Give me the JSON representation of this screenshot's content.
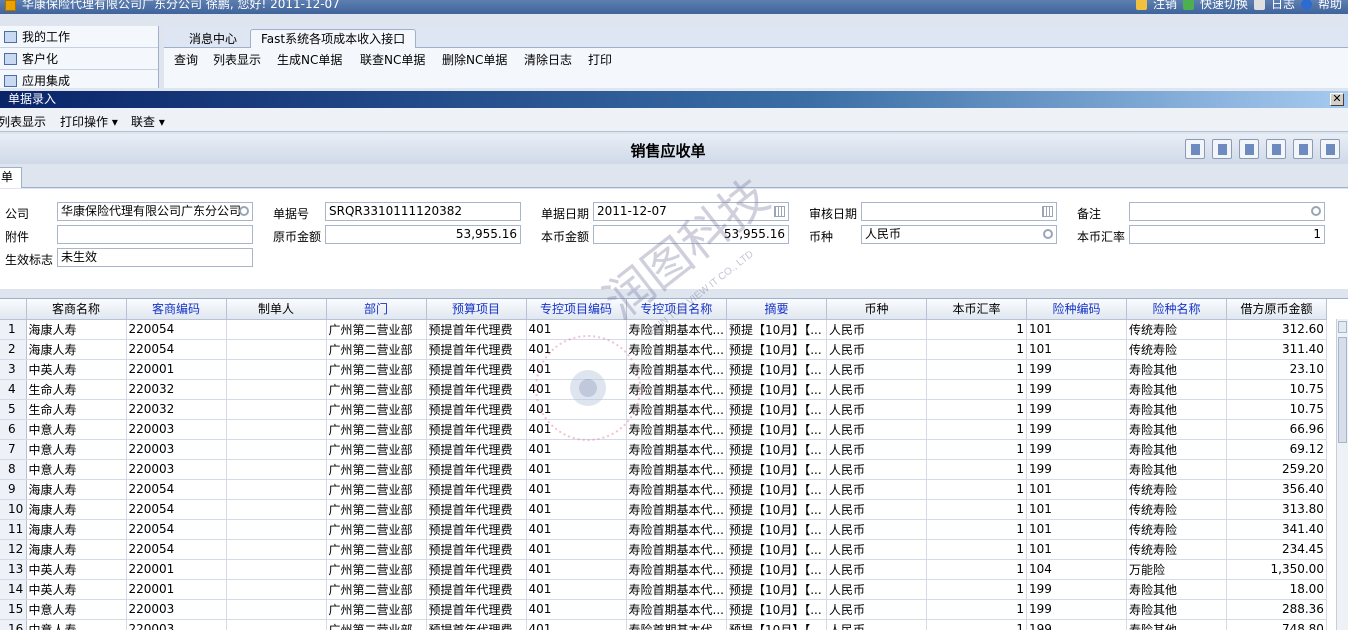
{
  "app": {
    "title": "华康保险代理有限公司广东分公司 徐鹏, 您好! 2011-12-07",
    "top_links": [
      "注销",
      "快速切换",
      "日志",
      "帮助"
    ]
  },
  "left_nav": {
    "items": [
      "我的工作",
      "客户化",
      "应用集成"
    ]
  },
  "tabs": [
    "消息中心",
    "Fast系统各项成本收入接口"
  ],
  "toolbar": [
    "查询",
    "列表显示",
    "生成NC单据",
    "联查NC单据",
    "删除NC单据",
    "清除日志",
    "打印"
  ],
  "window": {
    "title": "单据录入",
    "close": "✕"
  },
  "menu": [
    "列表显示",
    "打印操作 ▾",
    "联查 ▾"
  ],
  "form_title": "销售应收单",
  "sub_tab": "单据",
  "form": {
    "company_label": "公司",
    "company_value": "华康保险代理有限公司广东分公司",
    "doc_no_label": "单据号",
    "doc_no_value": "SRQR3310111120382",
    "doc_date_label": "单据日期",
    "doc_date_value": "2011-12-07",
    "audit_date_label": "审核日期",
    "audit_date_value": "",
    "remark_label": "备注",
    "remark_value": "",
    "attach_label": "附件",
    "attach_value": "",
    "orig_amount_label": "原币金额",
    "orig_amount_value": "53,955.16",
    "local_amount_label": "本币金额",
    "local_amount_value": "53,955.16",
    "currency_label": "币种",
    "currency_value": "人民币",
    "rate_label": "本币汇率",
    "rate_value": "1",
    "status_label": "生效标志",
    "status_value": "未生效"
  },
  "grid": {
    "columns": [
      "客商名称",
      "客商编码",
      "制单人",
      "部门",
      "预算项目",
      "专控项目编码",
      "专控项目名称",
      "摘要",
      "币种",
      "本币汇率",
      "险种编码",
      "险种名称",
      "借方原币金额"
    ],
    "rows": [
      [
        "1",
        "海康人寿",
        "220054",
        "",
        "广州第二营业部",
        "预提首年代理费",
        "401",
        "寿险首期基本代...",
        "预提【10月】【...",
        "人民币",
        "1",
        "101",
        "传统寿险",
        "312.60"
      ],
      [
        "2",
        "海康人寿",
        "220054",
        "",
        "广州第二营业部",
        "预提首年代理费",
        "401",
        "寿险首期基本代...",
        "预提【10月】【...",
        "人民币",
        "1",
        "101",
        "传统寿险",
        "311.40"
      ],
      [
        "3",
        "中英人寿",
        "220001",
        "",
        "广州第二营业部",
        "预提首年代理费",
        "401",
        "寿险首期基本代...",
        "预提【10月】【...",
        "人民币",
        "1",
        "199",
        "寿险其他",
        "23.10"
      ],
      [
        "4",
        "生命人寿",
        "220032",
        "",
        "广州第二营业部",
        "预提首年代理费",
        "401",
        "寿险首期基本代...",
        "预提【10月】【...",
        "人民币",
        "1",
        "199",
        "寿险其他",
        "10.75"
      ],
      [
        "5",
        "生命人寿",
        "220032",
        "",
        "广州第二营业部",
        "预提首年代理费",
        "401",
        "寿险首期基本代...",
        "预提【10月】【...",
        "人民币",
        "1",
        "199",
        "寿险其他",
        "10.75"
      ],
      [
        "6",
        "中意人寿",
        "220003",
        "",
        "广州第二营业部",
        "预提首年代理费",
        "401",
        "寿险首期基本代...",
        "预提【10月】【...",
        "人民币",
        "1",
        "199",
        "寿险其他",
        "66.96"
      ],
      [
        "7",
        "中意人寿",
        "220003",
        "",
        "广州第二营业部",
        "预提首年代理费",
        "401",
        "寿险首期基本代...",
        "预提【10月】【...",
        "人民币",
        "1",
        "199",
        "寿险其他",
        "69.12"
      ],
      [
        "8",
        "中意人寿",
        "220003",
        "",
        "广州第二营业部",
        "预提首年代理费",
        "401",
        "寿险首期基本代...",
        "预提【10月】【...",
        "人民币",
        "1",
        "199",
        "寿险其他",
        "259.20"
      ],
      [
        "9",
        "海康人寿",
        "220054",
        "",
        "广州第二营业部",
        "预提首年代理费",
        "401",
        "寿险首期基本代...",
        "预提【10月】【...",
        "人民币",
        "1",
        "101",
        "传统寿险",
        "356.40"
      ],
      [
        "10",
        "海康人寿",
        "220054",
        "",
        "广州第二营业部",
        "预提首年代理费",
        "401",
        "寿险首期基本代...",
        "预提【10月】【...",
        "人民币",
        "1",
        "101",
        "传统寿险",
        "313.80"
      ],
      [
        "11",
        "海康人寿",
        "220054",
        "",
        "广州第二营业部",
        "预提首年代理费",
        "401",
        "寿险首期基本代...",
        "预提【10月】【...",
        "人民币",
        "1",
        "101",
        "传统寿险",
        "341.40"
      ],
      [
        "12",
        "海康人寿",
        "220054",
        "",
        "广州第二营业部",
        "预提首年代理费",
        "401",
        "寿险首期基本代...",
        "预提【10月】【...",
        "人民币",
        "1",
        "101",
        "传统寿险",
        "234.45"
      ],
      [
        "13",
        "中英人寿",
        "220001",
        "",
        "广州第二营业部",
        "预提首年代理费",
        "401",
        "寿险首期基本代...",
        "预提【10月】【...",
        "人民币",
        "1",
        "104",
        "万能险",
        "1,350.00"
      ],
      [
        "14",
        "中英人寿",
        "220001",
        "",
        "广州第二营业部",
        "预提首年代理费",
        "401",
        "寿险首期基本代...",
        "预提【10月】【...",
        "人民币",
        "1",
        "199",
        "寿险其他",
        "18.00"
      ],
      [
        "15",
        "中意人寿",
        "220003",
        "",
        "广州第二营业部",
        "预提首年代理费",
        "401",
        "寿险首期基本代...",
        "预提【10月】【...",
        "人民币",
        "1",
        "199",
        "寿险其他",
        "288.36"
      ],
      [
        "16",
        "中意人寿",
        "220003",
        "",
        "广州第二营业部",
        "预提首年代理费",
        "401",
        "寿险首期基本代...",
        "预提【10月】【...",
        "人民币",
        "1",
        "199",
        "寿险其他",
        "748.80"
      ]
    ]
  },
  "watermark": {
    "text": "润图科技",
    "sub": "RUN TOU VIEW IT CO., LTD"
  }
}
